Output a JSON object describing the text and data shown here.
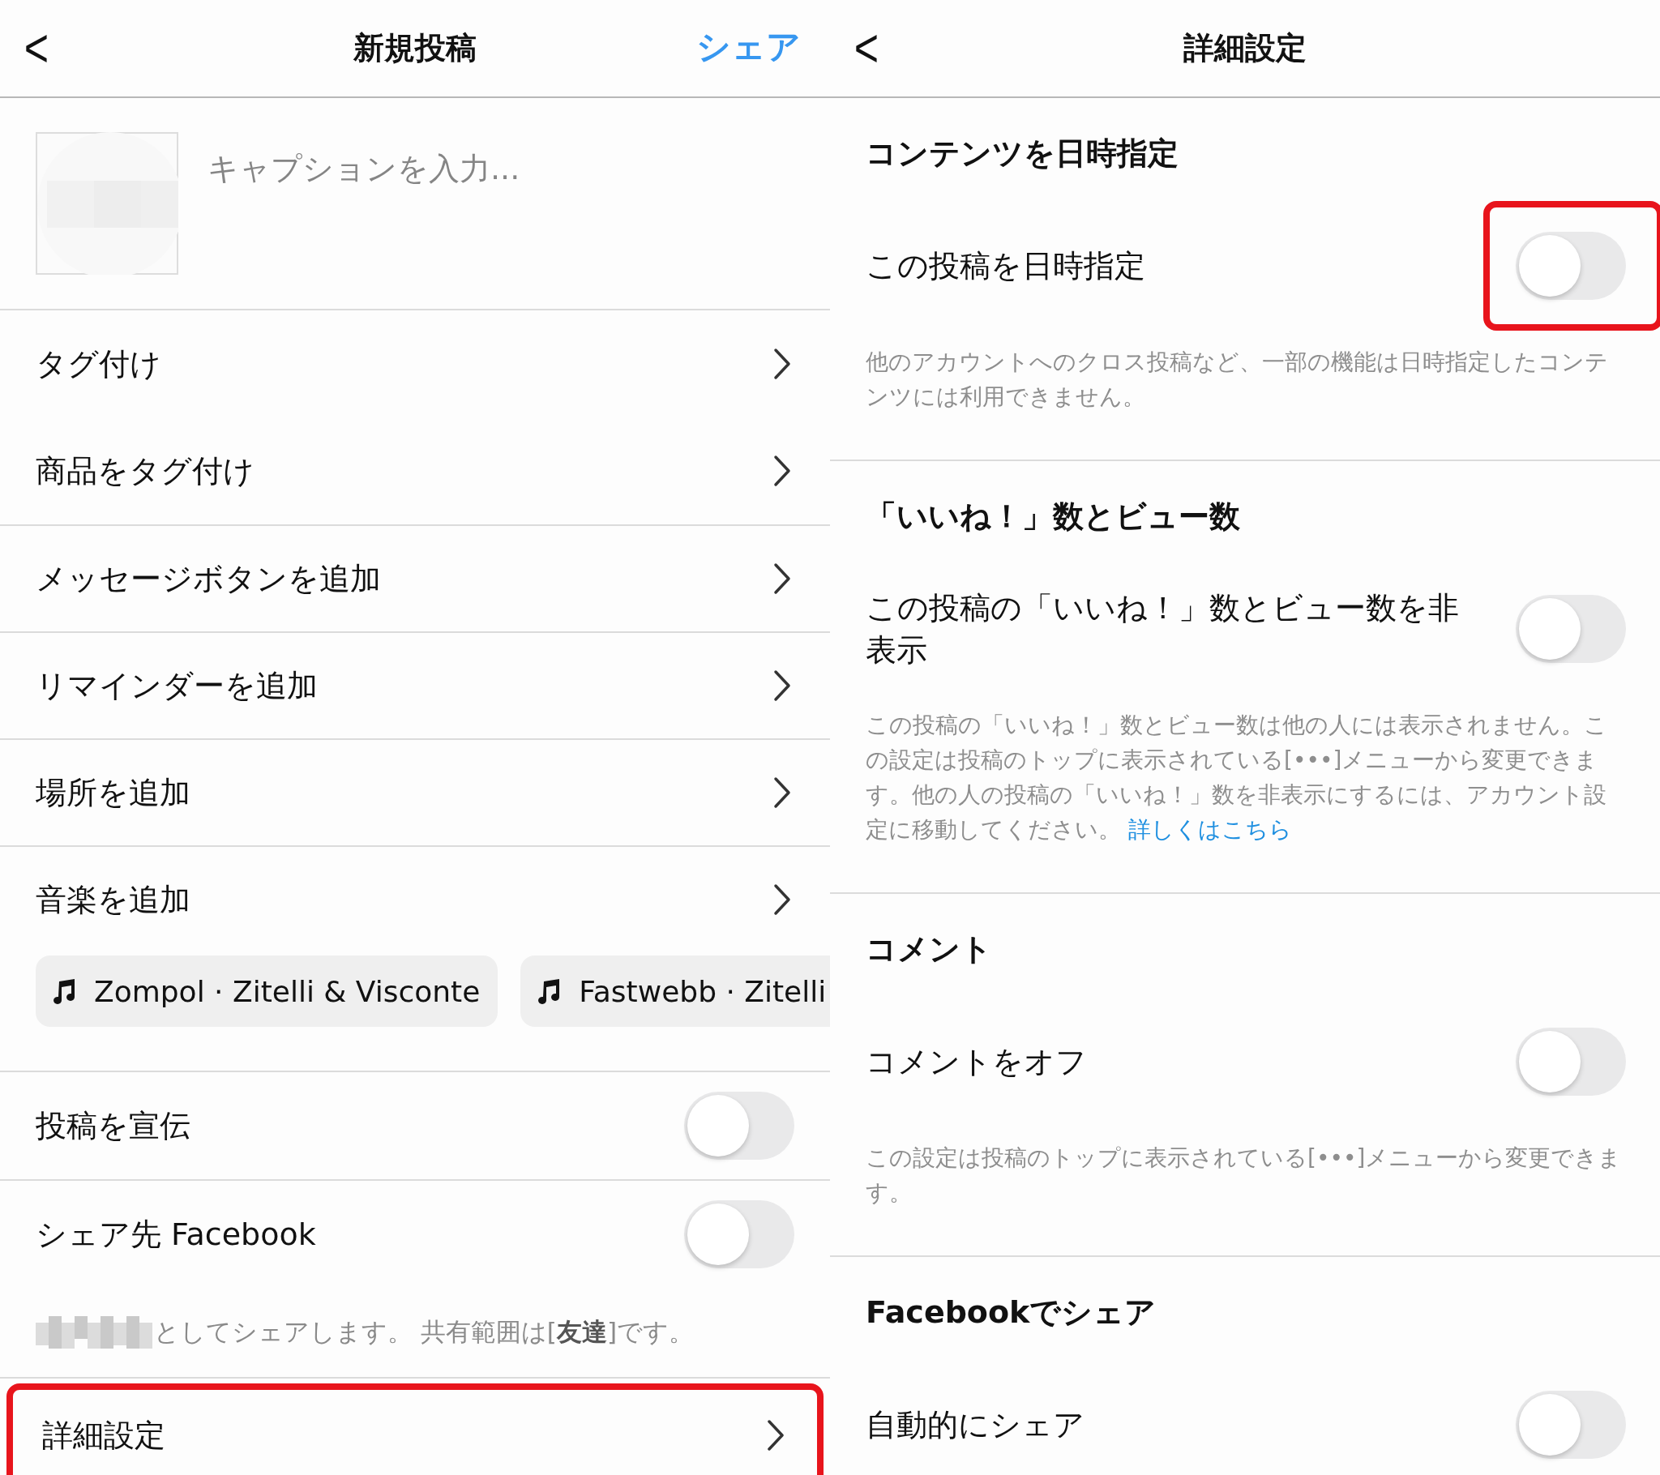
{
  "left": {
    "header": {
      "back": "<",
      "title": "新規投稿",
      "action": "シェア"
    },
    "caption": {
      "placeholder": "キャプションを入力..."
    },
    "nav_items": [
      {
        "label": "タグ付け"
      },
      {
        "label": "商品をタグ付け"
      },
      {
        "label": "メッセージボタンを追加"
      },
      {
        "label": "リマインダーを追加"
      },
      {
        "label": "場所を追加"
      },
      {
        "label": "音楽を追加"
      }
    ],
    "music_chips": [
      "Zompol · Zitelli & Visconte",
      "Fastwebb · Zitelli"
    ],
    "toggles": [
      {
        "label": "投稿を宣伝",
        "on": false
      },
      {
        "label": "シェア先 Facebook",
        "on": false
      }
    ],
    "share_note": "としてシェアします。 共有範囲は[**友達**]です。",
    "advanced": {
      "label": "詳細設定",
      "highlighted": true
    }
  },
  "right": {
    "header": {
      "back": "<",
      "title": "詳細設定"
    },
    "sections": [
      {
        "title": "コンテンツを日時指定",
        "setting": {
          "label": "この投稿を日時指定",
          "on": false,
          "highlighted": true
        },
        "description": "他のアカウントへのクロス投稿など、一部の機能は日時指定したコンテンツには利用できません。"
      },
      {
        "title": "「いいね！」数とビュー数",
        "setting": {
          "label": "この投稿の「いいね！」数とビュー数を非表示",
          "on": false,
          "highlighted": false
        },
        "description": "この投稿の「いいね！」数とビュー数は他の人には表示されません。この設定は投稿のトップに表示されている[•••]メニューから変更できます。他の人の投稿の「いいね！」数を非表示にするには、アカウント設定に移動してください。",
        "link": "詳しくはこちら"
      },
      {
        "title": "コメント",
        "setting": {
          "label": "コメントをオフ",
          "on": false,
          "highlighted": false
        },
        "description": "この設定は投稿のトップに表示されている[•••]メニューから変更できます。"
      },
      {
        "title": "Facebookでシェア",
        "setting": {
          "label": "自動的にシェア",
          "on": false,
          "highlighted": false
        }
      }
    ]
  }
}
